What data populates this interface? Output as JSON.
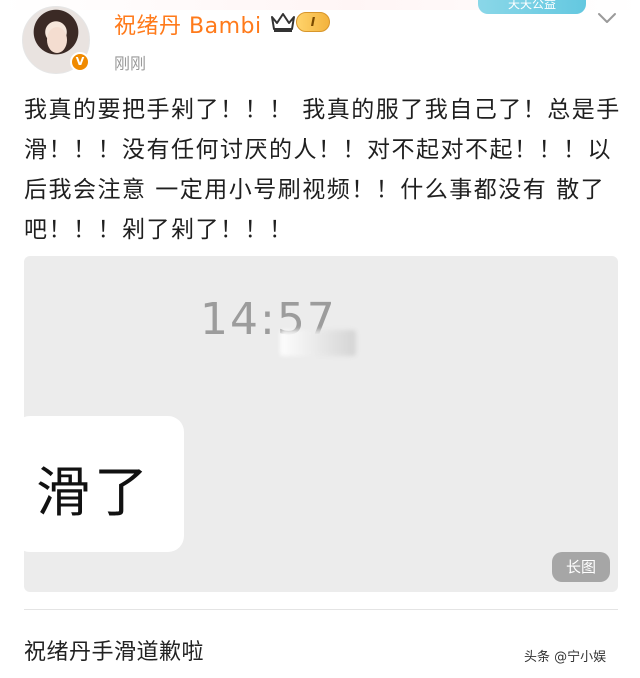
{
  "header": {
    "username": "祝绪丹 Bambi",
    "vip_level": "I",
    "timestamp": "刚刚",
    "banner_text": "天天公益"
  },
  "post": {
    "text": "我真的要把手剁了！！！ 我真的服了我自己了！总是手滑！！！没有任何讨厌的人！！对不起对不起！！！以后我会注意 一定用小号刷视频！！什么事都没有 散了吧！！！剁了剁了！！！"
  },
  "image": {
    "clock_text": "14:57",
    "bubble_text": "滑了",
    "long_image_label": "长图"
  },
  "footer": {
    "headline": "祝绪丹手滑道歉啦",
    "watermark": "头条 @宁小娱"
  },
  "colors": {
    "username": "#ff7a1a",
    "verified": "#f08a00",
    "image_bg": "#ececec"
  },
  "icons": [
    "verified-icon",
    "crown-icon",
    "chevron-down-icon"
  ]
}
